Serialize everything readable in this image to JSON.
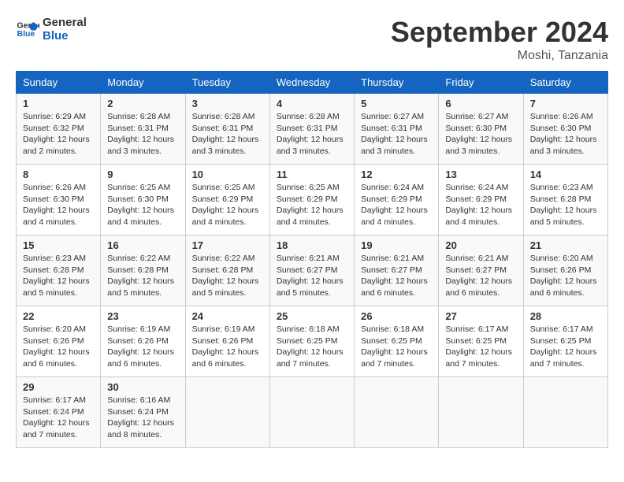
{
  "logo": {
    "line1": "General",
    "line2": "Blue"
  },
  "title": "September 2024",
  "subtitle": "Moshi, Tanzania",
  "days_of_week": [
    "Sunday",
    "Monday",
    "Tuesday",
    "Wednesday",
    "Thursday",
    "Friday",
    "Saturday"
  ],
  "weeks": [
    [
      {
        "day": "1",
        "sunrise": "6:29 AM",
        "sunset": "6:32 PM",
        "daylight": "12 hours and 2 minutes."
      },
      {
        "day": "2",
        "sunrise": "6:28 AM",
        "sunset": "6:31 PM",
        "daylight": "12 hours and 3 minutes."
      },
      {
        "day": "3",
        "sunrise": "6:28 AM",
        "sunset": "6:31 PM",
        "daylight": "12 hours and 3 minutes."
      },
      {
        "day": "4",
        "sunrise": "6:28 AM",
        "sunset": "6:31 PM",
        "daylight": "12 hours and 3 minutes."
      },
      {
        "day": "5",
        "sunrise": "6:27 AM",
        "sunset": "6:31 PM",
        "daylight": "12 hours and 3 minutes."
      },
      {
        "day": "6",
        "sunrise": "6:27 AM",
        "sunset": "6:30 PM",
        "daylight": "12 hours and 3 minutes."
      },
      {
        "day": "7",
        "sunrise": "6:26 AM",
        "sunset": "6:30 PM",
        "daylight": "12 hours and 3 minutes."
      }
    ],
    [
      {
        "day": "8",
        "sunrise": "6:26 AM",
        "sunset": "6:30 PM",
        "daylight": "12 hours and 4 minutes."
      },
      {
        "day": "9",
        "sunrise": "6:25 AM",
        "sunset": "6:30 PM",
        "daylight": "12 hours and 4 minutes."
      },
      {
        "day": "10",
        "sunrise": "6:25 AM",
        "sunset": "6:29 PM",
        "daylight": "12 hours and 4 minutes."
      },
      {
        "day": "11",
        "sunrise": "6:25 AM",
        "sunset": "6:29 PM",
        "daylight": "12 hours and 4 minutes."
      },
      {
        "day": "12",
        "sunrise": "6:24 AM",
        "sunset": "6:29 PM",
        "daylight": "12 hours and 4 minutes."
      },
      {
        "day": "13",
        "sunrise": "6:24 AM",
        "sunset": "6:29 PM",
        "daylight": "12 hours and 4 minutes."
      },
      {
        "day": "14",
        "sunrise": "6:23 AM",
        "sunset": "6:28 PM",
        "daylight": "12 hours and 5 minutes."
      }
    ],
    [
      {
        "day": "15",
        "sunrise": "6:23 AM",
        "sunset": "6:28 PM",
        "daylight": "12 hours and 5 minutes."
      },
      {
        "day": "16",
        "sunrise": "6:22 AM",
        "sunset": "6:28 PM",
        "daylight": "12 hours and 5 minutes."
      },
      {
        "day": "17",
        "sunrise": "6:22 AM",
        "sunset": "6:28 PM",
        "daylight": "12 hours and 5 minutes."
      },
      {
        "day": "18",
        "sunrise": "6:21 AM",
        "sunset": "6:27 PM",
        "daylight": "12 hours and 5 minutes."
      },
      {
        "day": "19",
        "sunrise": "6:21 AM",
        "sunset": "6:27 PM",
        "daylight": "12 hours and 6 minutes."
      },
      {
        "day": "20",
        "sunrise": "6:21 AM",
        "sunset": "6:27 PM",
        "daylight": "12 hours and 6 minutes."
      },
      {
        "day": "21",
        "sunrise": "6:20 AM",
        "sunset": "6:26 PM",
        "daylight": "12 hours and 6 minutes."
      }
    ],
    [
      {
        "day": "22",
        "sunrise": "6:20 AM",
        "sunset": "6:26 PM",
        "daylight": "12 hours and 6 minutes."
      },
      {
        "day": "23",
        "sunrise": "6:19 AM",
        "sunset": "6:26 PM",
        "daylight": "12 hours and 6 minutes."
      },
      {
        "day": "24",
        "sunrise": "6:19 AM",
        "sunset": "6:26 PM",
        "daylight": "12 hours and 6 minutes."
      },
      {
        "day": "25",
        "sunrise": "6:18 AM",
        "sunset": "6:25 PM",
        "daylight": "12 hours and 7 minutes."
      },
      {
        "day": "26",
        "sunrise": "6:18 AM",
        "sunset": "6:25 PM",
        "daylight": "12 hours and 7 minutes."
      },
      {
        "day": "27",
        "sunrise": "6:17 AM",
        "sunset": "6:25 PM",
        "daylight": "12 hours and 7 minutes."
      },
      {
        "day": "28",
        "sunrise": "6:17 AM",
        "sunset": "6:25 PM",
        "daylight": "12 hours and 7 minutes."
      }
    ],
    [
      {
        "day": "29",
        "sunrise": "6:17 AM",
        "sunset": "6:24 PM",
        "daylight": "12 hours and 7 minutes."
      },
      {
        "day": "30",
        "sunrise": "6:16 AM",
        "sunset": "6:24 PM",
        "daylight": "12 hours and 8 minutes."
      },
      null,
      null,
      null,
      null,
      null
    ]
  ]
}
